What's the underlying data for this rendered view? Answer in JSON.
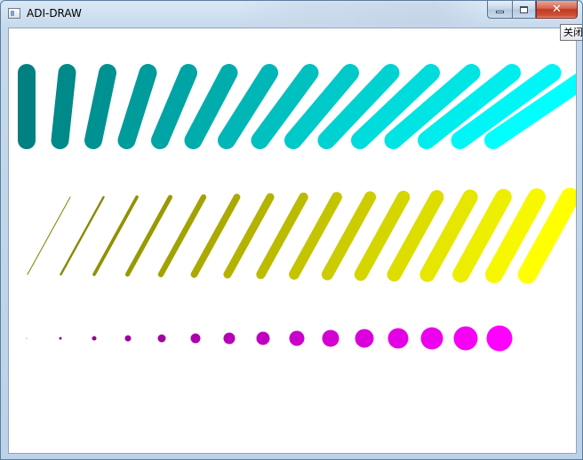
{
  "window": {
    "title": "ADI-DRAW",
    "icon": "app-window-icon"
  },
  "caption_buttons": {
    "minimize_icon": "minimize-icon",
    "maximize_icon": "maximize-icon",
    "close_icon": "close-icon",
    "close_glyph": "✕"
  },
  "tooltip": {
    "text": "关闭"
  },
  "drawing": {
    "rows": [
      {
        "name": "thick-slanted-strokes",
        "count": 15,
        "color_start": "#008080",
        "color_end": "#00ffff"
      },
      {
        "name": "growing-width-lines",
        "count": 16,
        "color_start": "#808000",
        "color_end": "#ffff00"
      },
      {
        "name": "growing-dots",
        "count": 15,
        "color_start": "#800080",
        "color_end": "#ff00ff"
      }
    ]
  }
}
